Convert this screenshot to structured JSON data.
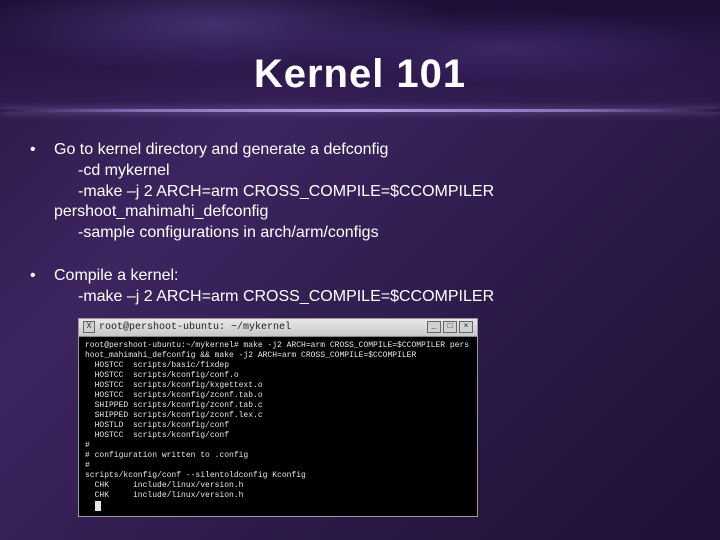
{
  "title": "Kernel 101",
  "bullets": [
    {
      "lead": "Go to kernel directory and generate a defconfig",
      "subs": [
        "-cd mykernel",
        "-make –j 2 ARCH=arm CROSS_COMPILE=$CCOMPILER",
        "pershoot_mahimahi_defconfig",
        "-sample configurations in arch/arm/configs"
      ],
      "sub_indent": [
        true,
        true,
        false,
        true
      ]
    },
    {
      "lead": "Compile a kernel:",
      "subs": [
        "-make –j 2 ARCH=arm CROSS_COMPILE=$CCOMPILER"
      ],
      "sub_indent": [
        true
      ]
    }
  ],
  "terminal": {
    "title": "root@pershoot-ubuntu: ~/mykernel",
    "lines": [
      "root@pershoot-ubuntu:~/mykernel# make -j2 ARCH=arm CROSS_COMPILE=$CCOMPILER pers",
      "hoot_mahimahi_defconfig && make -j2 ARCH=arm CROSS_COMPILE=$CCOMPILER",
      "  HOSTCC  scripts/basic/fixdep",
      "  HOSTCC  scripts/kconfig/conf.o",
      "  HOSTCC  scripts/kconfig/kxgettext.o",
      "  HOSTCC  scripts/kconfig/zconf.tab.o",
      "  SHIPPED scripts/kconfig/zconf.tab.c",
      "  SHIPPED scripts/kconfig/zconf.lex.c",
      "  HOSTLD  scripts/kconfig/conf",
      "  HOSTCC  scripts/kconfig/conf",
      "#",
      "# configuration written to .config",
      "#",
      "scripts/kconfig/conf --silentoldconfig Kconfig",
      "  CHK     include/linux/version.h",
      "  CHK     include/linux/version.h"
    ]
  }
}
